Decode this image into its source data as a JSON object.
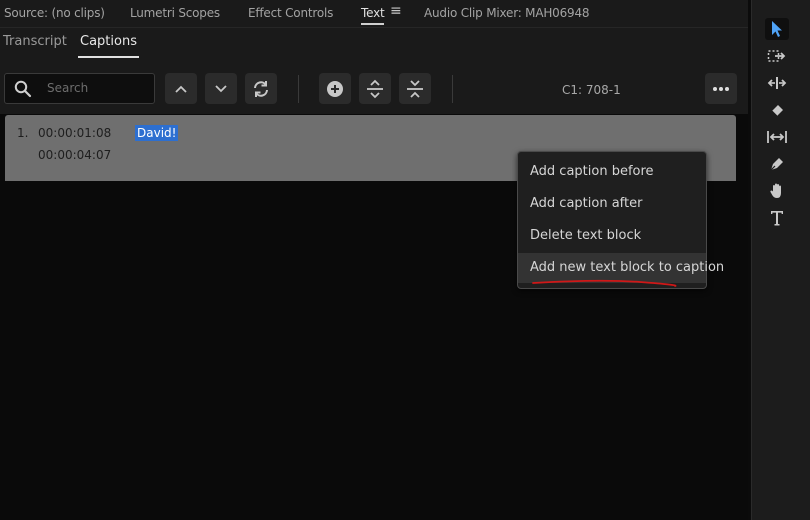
{
  "panel_tabs": [
    {
      "label": "Source: (no clips)"
    },
    {
      "label": "Lumetri Scopes"
    },
    {
      "label": "Effect Controls"
    },
    {
      "label": "Text"
    },
    {
      "label": "Audio Clip Mixer: MAH06948"
    }
  ],
  "panel_menu_icon": "≡",
  "sub_tabs": [
    {
      "label": "Transcript"
    },
    {
      "label": "Captions"
    }
  ],
  "search": {
    "placeholder": "Search"
  },
  "toolbar_icons": [
    "search-icon",
    "chevron-up-icon",
    "chevron-down-icon",
    "refresh-icon",
    "add-caption-icon",
    "split-caption-icon",
    "merge-caption-icon",
    "more-icon"
  ],
  "counter": "C1: 708-1",
  "caption": {
    "number": "1.",
    "in_time": "00:00:01:08",
    "out_time": "00:00:04:07",
    "text": "David!"
  },
  "context_menu": {
    "items": [
      {
        "label": "Add caption before"
      },
      {
        "label": "Add caption after"
      },
      {
        "label": "Delete text block"
      },
      {
        "label": "Add new text block to caption"
      }
    ],
    "highlighted_index": 3
  },
  "tools": [
    "selection-tool-icon",
    "track-select-icon",
    "ripple-edit-icon",
    "razor-icon",
    "slip-icon",
    "pen-icon",
    "hand-icon",
    "type-icon"
  ],
  "colors": {
    "selection": "#2d6fd0",
    "tool_accent": "#4fa3f7",
    "annotation": "#d01818"
  }
}
